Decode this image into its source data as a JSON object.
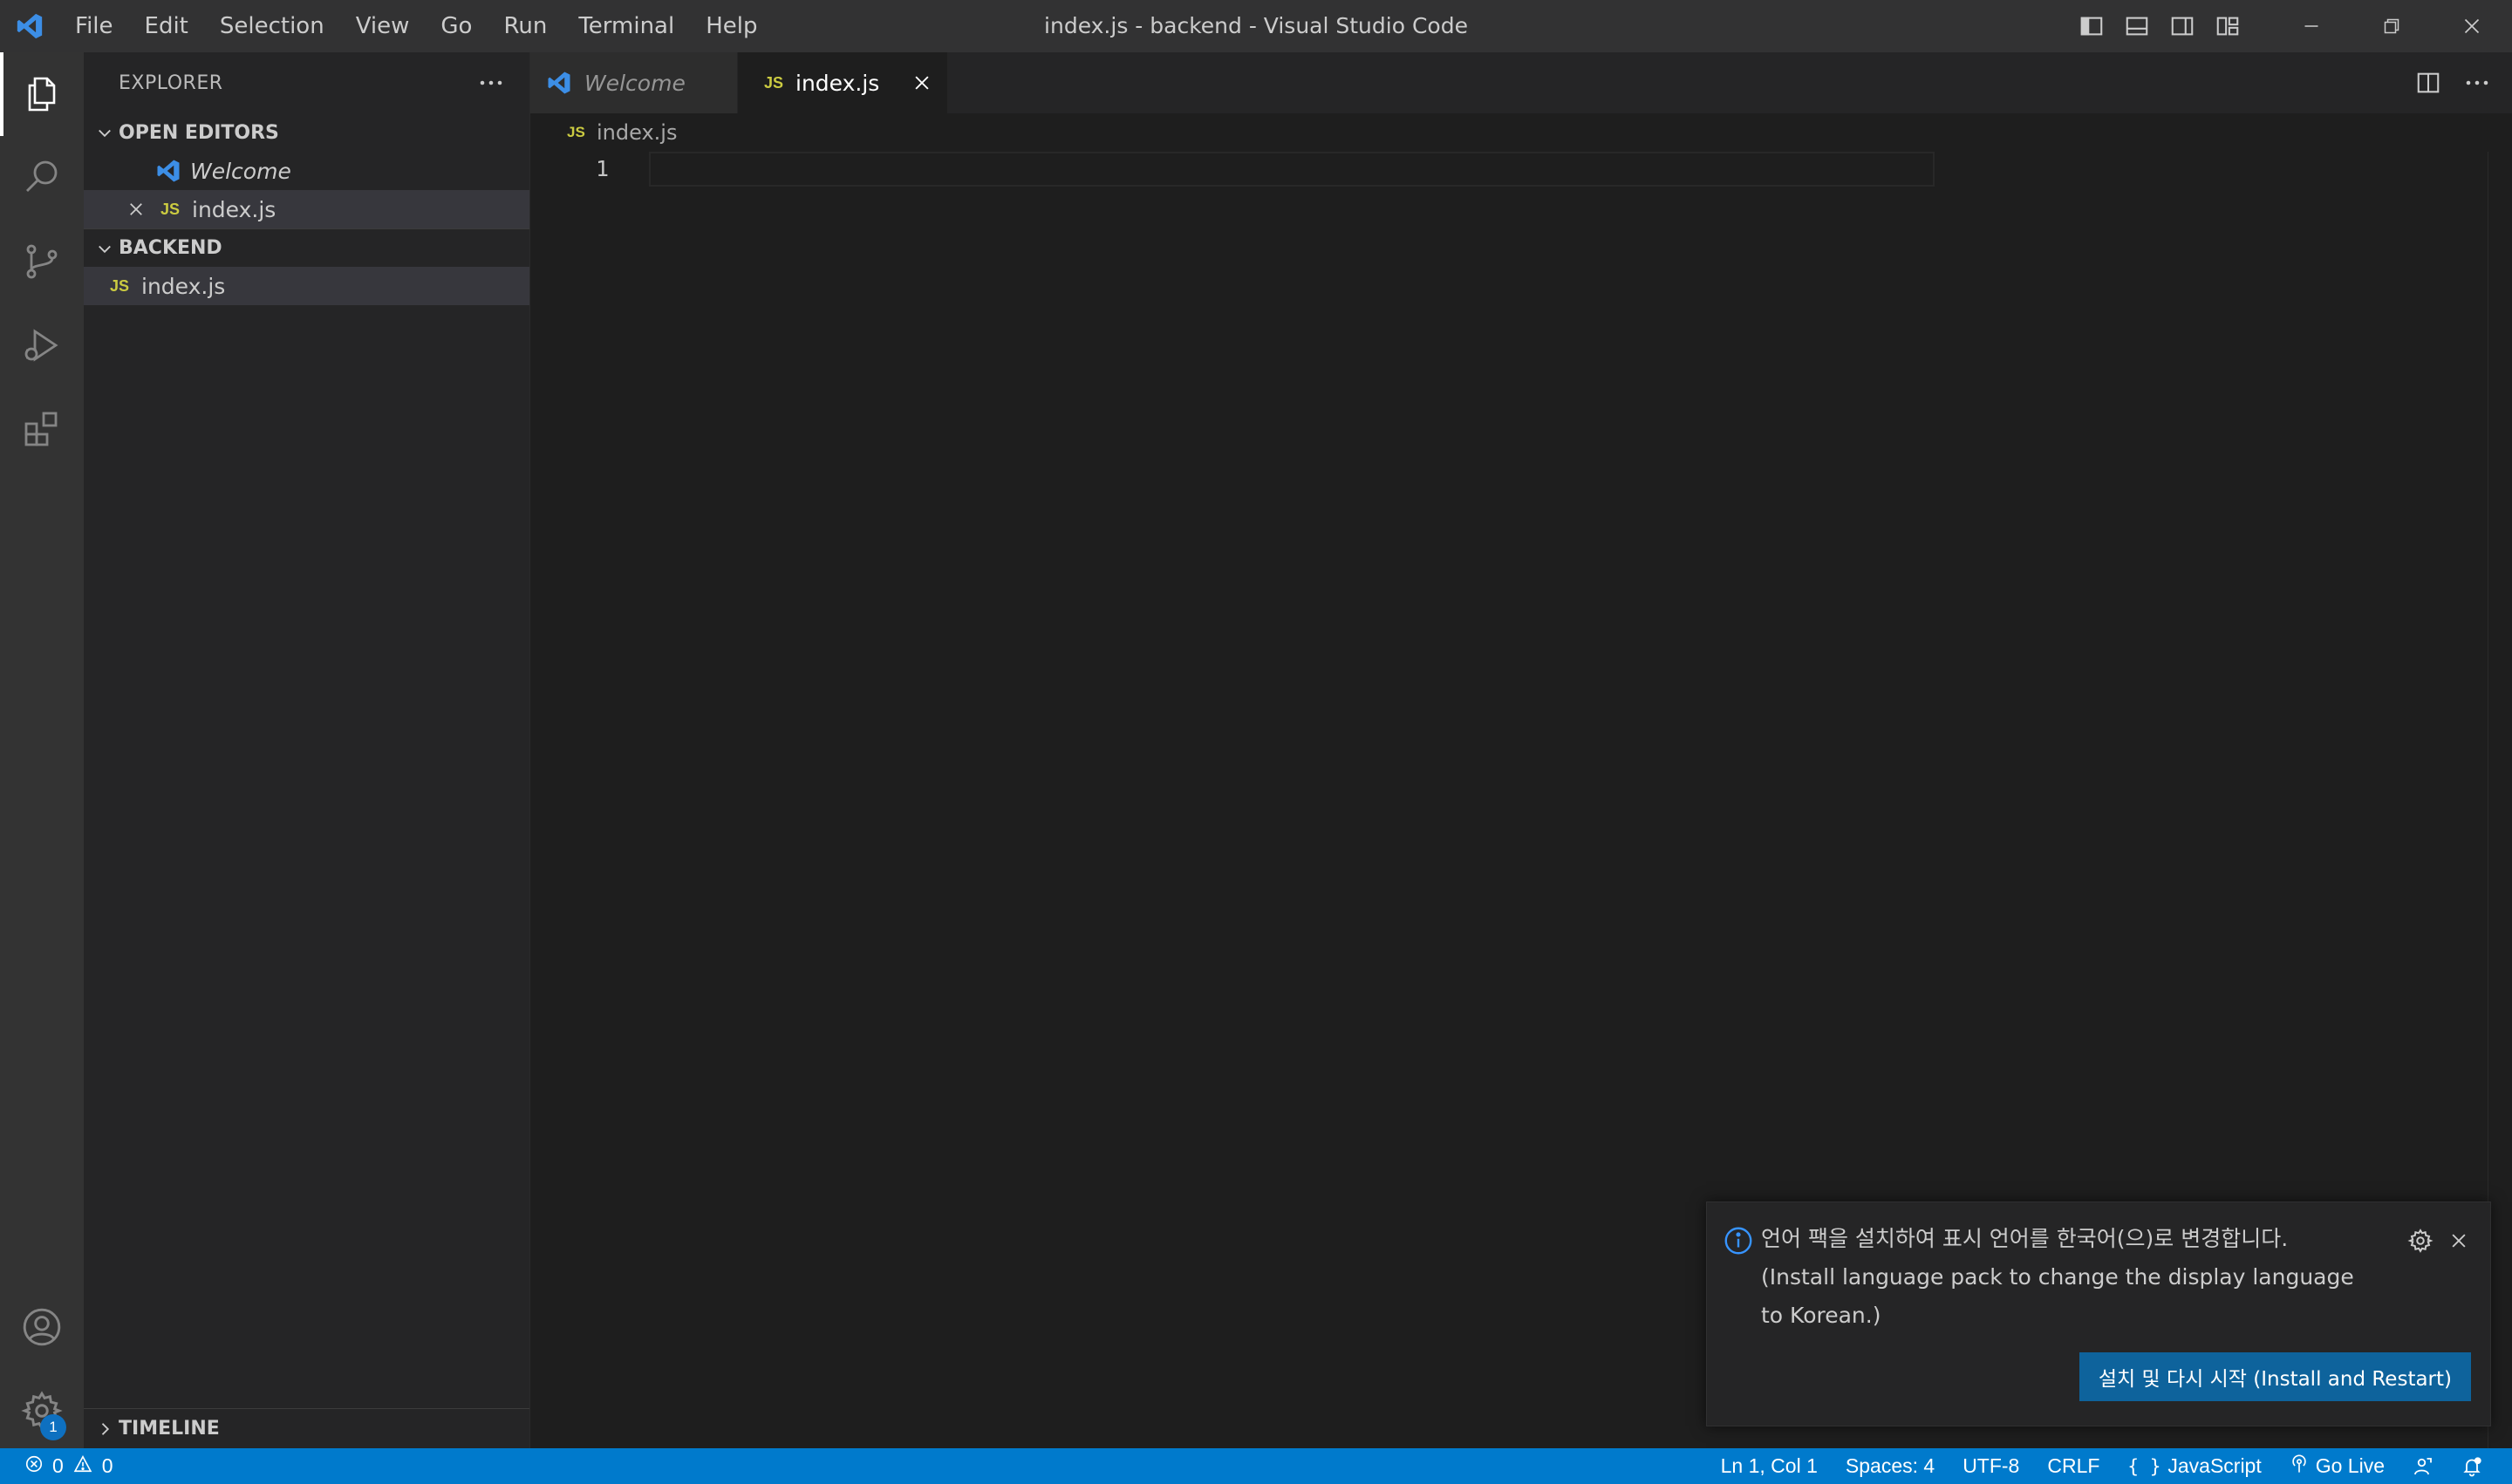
{
  "window": {
    "title": "index.js - backend - Visual Studio Code"
  },
  "menu": [
    "File",
    "Edit",
    "Selection",
    "View",
    "Go",
    "Run",
    "Terminal",
    "Help"
  ],
  "sidebar": {
    "title": "EXPLORER",
    "open_editors": {
      "label": "OPEN EDITORS",
      "items": [
        {
          "label": "Welcome",
          "icon": "vscode-icon"
        },
        {
          "label": "index.js",
          "icon": "JS"
        }
      ]
    },
    "folder": {
      "label": "BACKEND",
      "files": [
        {
          "label": "index.js",
          "icon": "JS"
        }
      ]
    },
    "timeline": "TIMELINE"
  },
  "tabs": [
    {
      "label": "Welcome",
      "icon": "vscode-icon",
      "active": false
    },
    {
      "label": "index.js",
      "icon": "JS",
      "active": true
    }
  ],
  "breadcrumb": {
    "icon": "JS",
    "label": "index.js"
  },
  "editor": {
    "line_number": "1"
  },
  "activity_badge": "1",
  "notification": {
    "message_line1": "언어 팩을 설치하여 표시 언어를 한국어(으)로 변경합니다.",
    "message_line2": "(Install language pack to change the display language to Korean.)",
    "button": "설치 및 다시 시작 (Install and Restart)"
  },
  "statusbar": {
    "errors": "0",
    "warnings": "0",
    "position": "Ln 1, Col 1",
    "spaces": "Spaces: 4",
    "encoding": "UTF-8",
    "eol": "CRLF",
    "language": "JavaScript",
    "go_live": "Go Live"
  },
  "colors": {
    "accent": "#007acc",
    "js_icon": "#cbcb41",
    "vscode_blue": "#3c8ee6"
  }
}
